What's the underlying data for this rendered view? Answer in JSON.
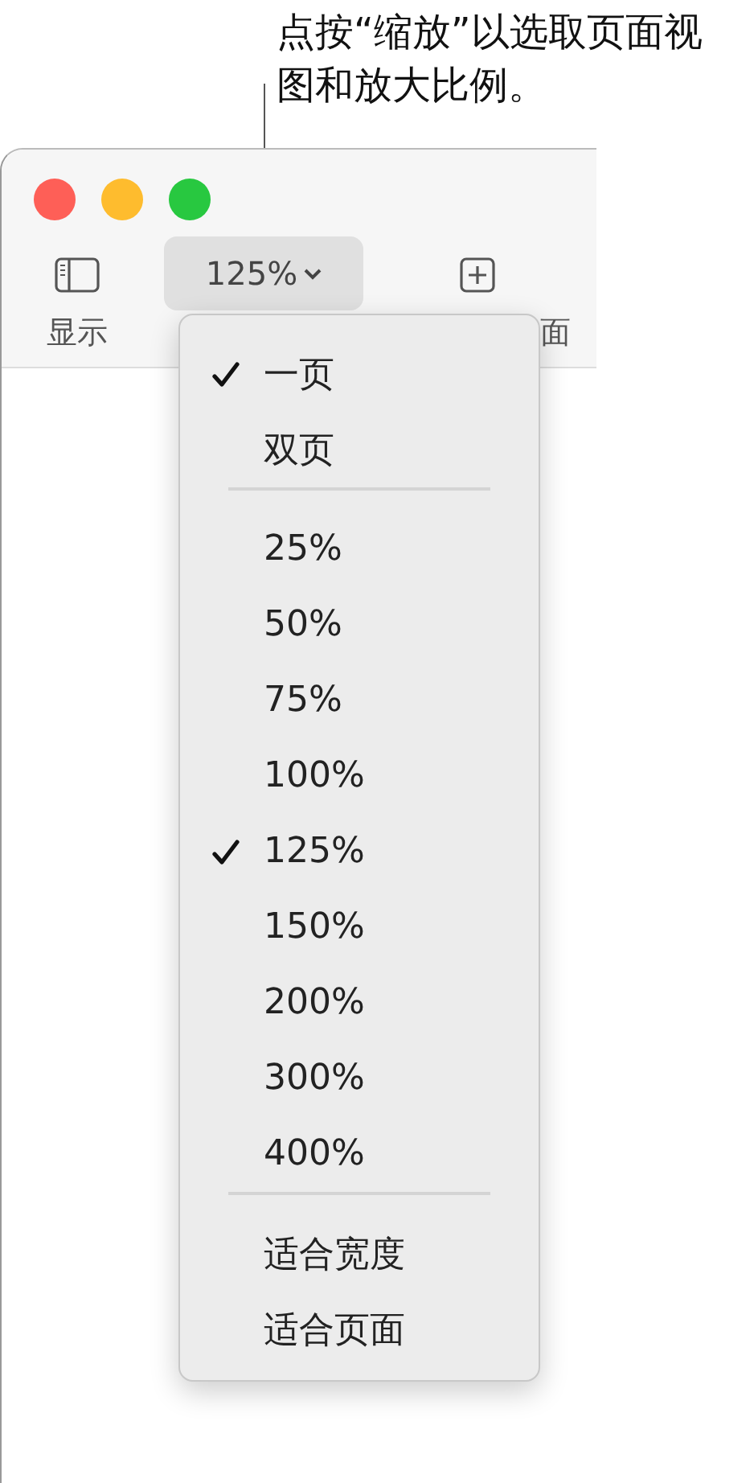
{
  "callout": {
    "text": "点按“缩放”以选取页面视图和放大比例。"
  },
  "window": {
    "toolbar": {
      "view": {
        "label": "显示"
      },
      "zoom": {
        "value": "125%"
      },
      "add": {
        "label": "面"
      }
    }
  },
  "zoom_menu": {
    "items": [
      {
        "kind": "item",
        "label": "一页",
        "selected": true
      },
      {
        "kind": "item",
        "label": "双页",
        "selected": false
      },
      {
        "kind": "separator"
      },
      {
        "kind": "item",
        "label": "25%",
        "selected": false
      },
      {
        "kind": "item",
        "label": "50%",
        "selected": false
      },
      {
        "kind": "item",
        "label": "75%",
        "selected": false
      },
      {
        "kind": "item",
        "label": "100%",
        "selected": false
      },
      {
        "kind": "item",
        "label": "125%",
        "selected": true
      },
      {
        "kind": "item",
        "label": "150%",
        "selected": false
      },
      {
        "kind": "item",
        "label": "200%",
        "selected": false
      },
      {
        "kind": "item",
        "label": "300%",
        "selected": false
      },
      {
        "kind": "item",
        "label": "400%",
        "selected": false
      },
      {
        "kind": "separator"
      },
      {
        "kind": "item",
        "label": "适合宽度",
        "selected": false
      },
      {
        "kind": "item",
        "label": "适合页面",
        "selected": false
      }
    ]
  }
}
